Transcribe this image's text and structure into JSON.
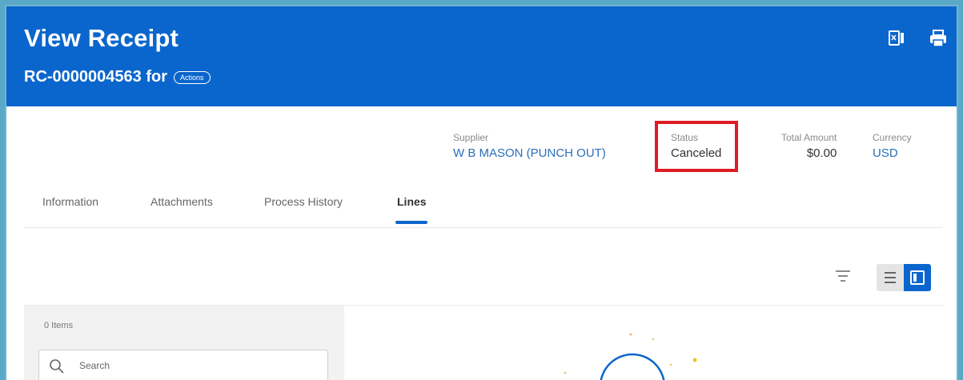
{
  "header": {
    "title": "View Receipt",
    "subtitle": "RC-0000004563 for",
    "actions_label": "Actions",
    "icons": [
      "export-to-excel-icon",
      "print-icon"
    ],
    "background_color": "#0a66cc"
  },
  "summary": {
    "supplier_label": "Supplier",
    "supplier_value": "W B MASON (PUNCH OUT)",
    "status_label": "Status",
    "status_value": "Canceled",
    "total_label": "Total Amount",
    "total_value": "$0.00",
    "currency_label": "Currency",
    "currency_value": "USD",
    "highlight_color": "#e01b24"
  },
  "tabs": [
    {
      "label": "Information",
      "active": false
    },
    {
      "label": "Attachments",
      "active": false
    },
    {
      "label": "Process History",
      "active": false
    },
    {
      "label": "Lines",
      "active": true
    }
  ],
  "toolbar": {
    "icons": [
      "filter-icon",
      "list-view-icon",
      "detail-view-icon"
    ]
  },
  "list_panel": {
    "items_count": "0 Items",
    "search_placeholder": "Search"
  }
}
